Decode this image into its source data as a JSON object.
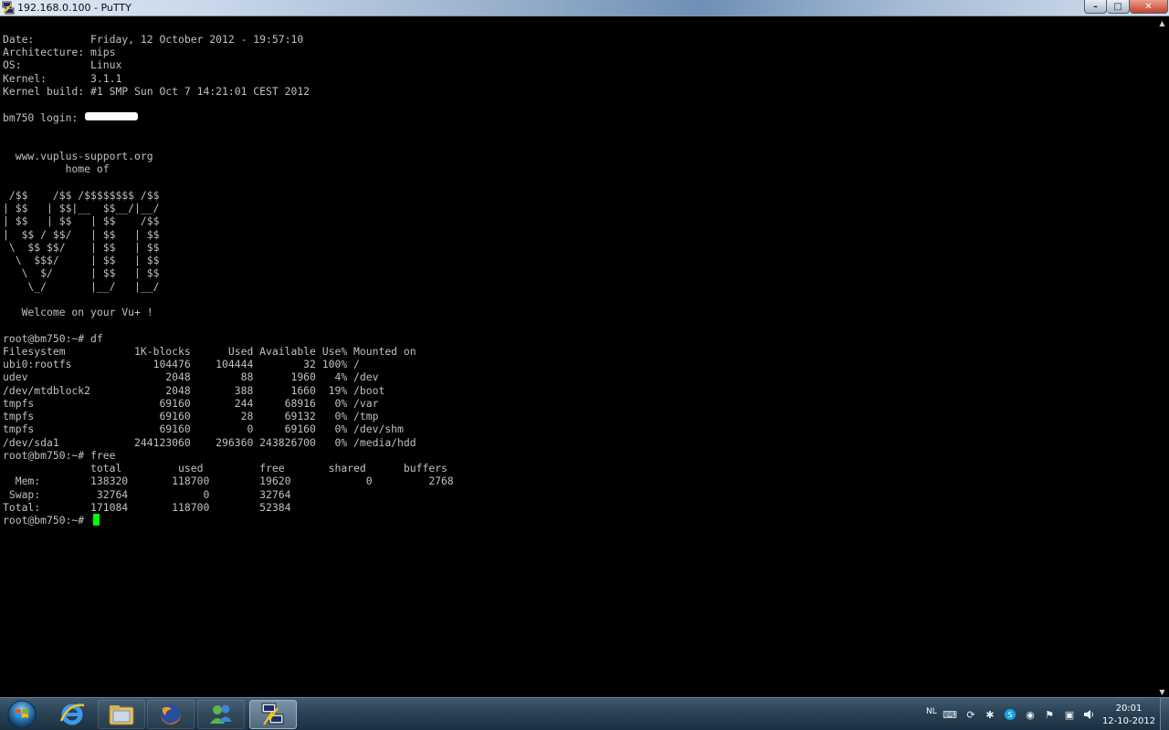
{
  "window": {
    "title": "192.168.0.100 - PuTTY",
    "buttons": {
      "minimize": "–",
      "maximize": "□",
      "close": "✕"
    }
  },
  "terminal": {
    "lines": [
      "",
      "Date:         Friday, 12 October 2012 - 19:57:10",
      "Architecture: mips",
      "OS:           Linux",
      "Kernel:       3.1.1",
      "Kernel build: #1 SMP Sun Oct 7 14:21:01 CEST 2012",
      "",
      "bm750 login: ",
      "",
      "",
      "  www.vuplus-support.org",
      "          home of",
      "",
      " /$$    /$$ /$$$$$$$$ /$$",
      "| $$   | $$|__  $$__/|__/",
      "| $$   | $$   | $$    /$$",
      "|  $$ / $$/   | $$   | $$",
      " \\  $$ $$/    | $$   | $$",
      "  \\  $$$/     | $$   | $$",
      "   \\  $/      | $$   | $$",
      "    \\_/       |__/   |__/",
      "",
      "   Welcome on your Vu+ !",
      "",
      "root@bm750:~# df",
      "Filesystem           1K-blocks      Used Available Use% Mounted on",
      "ubi0:rootfs             104476    104444        32 100% /",
      "udev                      2048        88      1960   4% /dev",
      "/dev/mtdblock2            2048       388      1660  19% /boot",
      "tmpfs                    69160       244     68916   0% /var",
      "tmpfs                    69160        28     69132   0% /tmp",
      "tmpfs                    69160         0     69160   0% /dev/shm",
      "/dev/sda1            244123060    296360 243826700   0% /media/hdd",
      "root@bm750:~# free",
      "              total         used         free       shared      buffers",
      "  Mem:        138320       118700        19620            0         2768",
      " Swap:         32764            0        32764",
      "Total:        171084       118700        52384",
      "root@bm750:~# "
    ],
    "colors": {
      "foreground": "#c0c0c0",
      "background": "#000000",
      "cursor": "#00ff00"
    }
  },
  "taskbar": {
    "items": [
      {
        "name": "internet-explorer-icon"
      },
      {
        "name": "windows-explorer-icon"
      },
      {
        "name": "firefox-icon"
      },
      {
        "name": "messenger-icon"
      },
      {
        "name": "putty-icon"
      }
    ],
    "language": "NL",
    "tray_icons": [
      "keyboard-icon",
      "sync-icon",
      "network-tool-icon",
      "skype-icon",
      "webcam-icon",
      "flag-icon",
      "network-icon",
      "volume-icon"
    ],
    "clock": {
      "time": "20:01",
      "date": "12-10-2012"
    }
  }
}
